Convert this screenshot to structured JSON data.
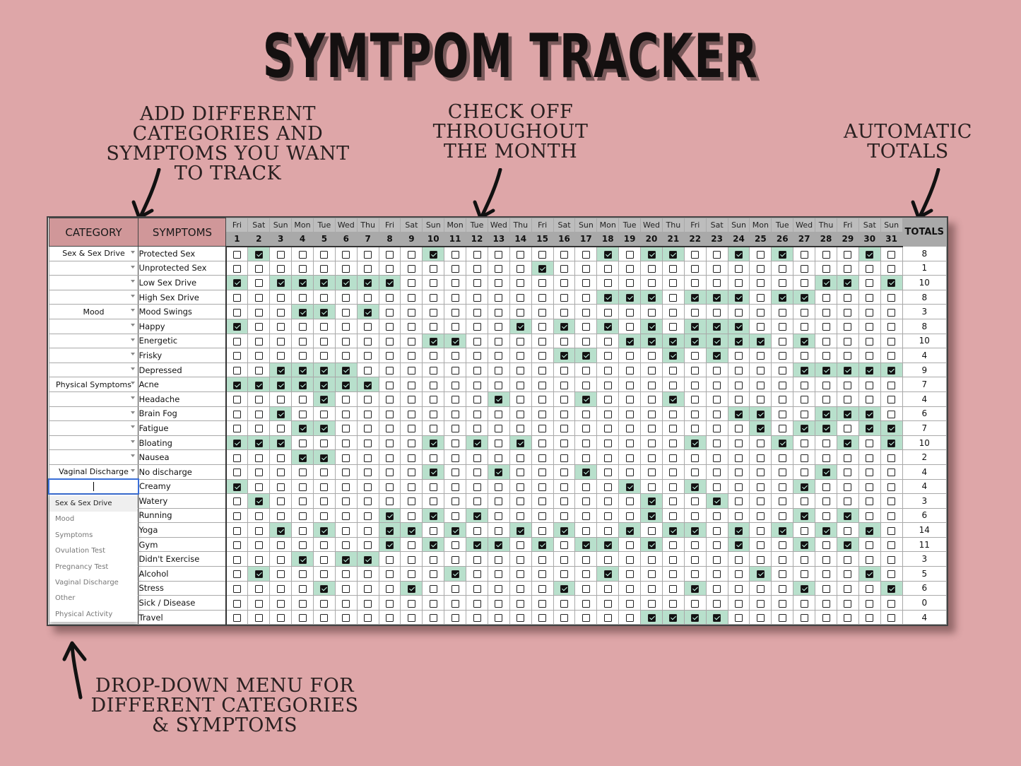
{
  "title": "SYMTPOM TRACKER",
  "annotations": {
    "add_categories": "ADD DIFFERENT\nCATEGORIES AND\nSYMPTOMS YOU WANT\nTO TRACK",
    "check_off": "CHECK OFF\nTHROUGHOUT\nTHE MONTH",
    "automatic_totals": "AUTOMATIC\nTOTALS",
    "dropdown_menu": "DROP-DOWN MENU FOR\nDIFFERENT CATEGORIES\n& SYMPTOMS"
  },
  "colors": {
    "background": "#dea6a8",
    "header_pink": "#d09799",
    "header_grey": "#a9a9a9",
    "checked_cell": "#b8e0cc",
    "editing_border": "#3a6fd8"
  },
  "table": {
    "category_header": "CATEGORY",
    "symptoms_header": "SYMPTOMS",
    "totals_header": "TOTALS",
    "weekdays": [
      "Fri",
      "Sat",
      "Sun",
      "Mon",
      "Tue",
      "Wed",
      "Thu",
      "Fri",
      "Sat",
      "Sun",
      "Mon",
      "Tue",
      "Wed",
      "Thu",
      "Fri",
      "Sat",
      "Sun",
      "Mon",
      "Tue",
      "Wed",
      "Thu",
      "Fri",
      "Sat",
      "Sun",
      "Mon",
      "Tue",
      "Wed",
      "Thu",
      "Fri",
      "Sat",
      "Sun"
    ],
    "days": [
      1,
      2,
      3,
      4,
      5,
      6,
      7,
      8,
      9,
      10,
      11,
      12,
      13,
      14,
      15,
      16,
      17,
      18,
      19,
      20,
      21,
      22,
      23,
      24,
      25,
      26,
      27,
      28,
      29,
      30,
      31
    ],
    "rows": [
      {
        "category": "Sex & Sex Drive",
        "symptom": "Protected Sex",
        "checked": [
          2,
          10,
          18,
          20,
          21,
          24,
          26,
          30
        ],
        "total": 8
      },
      {
        "category": "",
        "symptom": "Unprotected Sex",
        "checked": [
          15
        ],
        "total": 1
      },
      {
        "category": "",
        "symptom": "Low Sex Drive",
        "checked": [
          1,
          3,
          4,
          5,
          6,
          7,
          8,
          28,
          29,
          31
        ],
        "total": 10
      },
      {
        "category": "",
        "symptom": "High Sex Drive",
        "checked": [
          18,
          19,
          20,
          22,
          23,
          24,
          26,
          27
        ],
        "total": 8
      },
      {
        "category": "Mood",
        "symptom": "Mood Swings",
        "checked": [
          4,
          5,
          7
        ],
        "total": 3
      },
      {
        "category": "",
        "symptom": "Happy",
        "checked": [
          1,
          14,
          16,
          18,
          20,
          22,
          23,
          24
        ],
        "total": 8
      },
      {
        "category": "",
        "symptom": "Energetic",
        "checked": [
          10,
          11,
          19,
          20,
          21,
          22,
          23,
          24,
          25,
          27
        ],
        "total": 10
      },
      {
        "category": "",
        "symptom": "Frisky",
        "checked": [
          16,
          17,
          21,
          23
        ],
        "total": 4
      },
      {
        "category": "",
        "symptom": "Depressed",
        "checked": [
          3,
          4,
          5,
          6,
          27,
          28,
          29,
          30,
          31
        ],
        "total": 9
      },
      {
        "category": "Physical Symptoms",
        "symptom": "Acne",
        "checked": [
          1,
          2,
          3,
          4,
          5,
          6,
          7
        ],
        "total": 7
      },
      {
        "category": "",
        "symptom": "Headache",
        "checked": [
          5,
          13,
          17,
          21
        ],
        "total": 4
      },
      {
        "category": "",
        "symptom": "Brain Fog",
        "checked": [
          3,
          24,
          25,
          28,
          29,
          30
        ],
        "total": 6
      },
      {
        "category": "",
        "symptom": "Fatigue",
        "checked": [
          4,
          5,
          25,
          27,
          28,
          30,
          31
        ],
        "total": 7
      },
      {
        "category": "",
        "symptom": "Bloating",
        "checked": [
          1,
          2,
          3,
          10,
          12,
          14,
          22,
          26,
          29,
          31
        ],
        "total": 10
      },
      {
        "category": "",
        "symptom": "Nausea",
        "checked": [
          4,
          5
        ],
        "total": 2
      },
      {
        "category": "Vaginal Discharge",
        "symptom": "No discharge",
        "checked": [
          10,
          13,
          17,
          28
        ],
        "total": 4
      },
      {
        "category": "",
        "symptom": "Creamy",
        "checked": [
          1,
          19,
          22,
          27
        ],
        "total": 4,
        "editing": true
      },
      {
        "category": "",
        "symptom": "Watery",
        "checked": [
          2,
          20,
          23
        ],
        "total": 3
      },
      {
        "category": "",
        "symptom": "Running",
        "checked": [
          8,
          10,
          12,
          20,
          27,
          29
        ],
        "total": 6
      },
      {
        "category": "",
        "symptom": "Yoga",
        "checked": [
          3,
          5,
          8,
          9,
          11,
          14,
          16,
          19,
          21,
          22,
          24,
          26,
          28,
          30
        ],
        "total": 14
      },
      {
        "category": "",
        "symptom": "Gym",
        "checked": [
          8,
          10,
          12,
          13,
          15,
          17,
          18,
          20,
          24,
          27,
          29
        ],
        "total": 11
      },
      {
        "category": "",
        "symptom": "Didn't Exercise",
        "checked": [
          4,
          6,
          7
        ],
        "total": 3
      },
      {
        "category": "",
        "symptom": "Alcohol",
        "checked": [
          2,
          11,
          18,
          25,
          30
        ],
        "total": 5
      },
      {
        "category": "",
        "symptom": "Stress",
        "checked": [
          5,
          9,
          16,
          22,
          27,
          31
        ],
        "total": 6
      },
      {
        "category": "",
        "symptom": "Sick / Disease",
        "checked": [],
        "total": 0
      },
      {
        "category": "",
        "symptom": "Travel",
        "checked": [
          20,
          21,
          22,
          23
        ],
        "total": 4
      }
    ]
  },
  "dropdown": {
    "options": [
      "Sex & Sex Drive",
      "Mood",
      "Symptoms",
      "Ovulation Test",
      "Pregnancy Test",
      "Vaginal Discharge",
      "Other",
      "Physical Activity"
    ],
    "highlighted": "Sex & Sex Drive"
  },
  "icons": {
    "dropdown_arrow": "chevron-down-icon",
    "checkbox_checked": "checkbox-checked-icon",
    "checkbox_unchecked": "checkbox-empty-icon",
    "annotation_arrow": "hand-drawn-arrow-icon"
  }
}
